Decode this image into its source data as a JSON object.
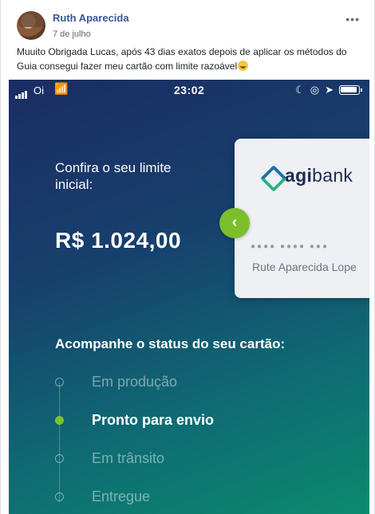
{
  "post": {
    "author": "Ruth Aparecida",
    "date": "7 de julho",
    "more_label": "•••",
    "text": "Muuito Obrigada Lucas, após 43 dias exatos depois de aplicar os métodos do Guia consegui fazer meu cartão com limite razoável",
    "emoji": "laughing-face-emoji"
  },
  "phone": {
    "status_bar": {
      "carrier": "Oi",
      "time": "23:02",
      "icons": [
        "signal-icon",
        "wifi-icon",
        "moon-icon",
        "lock-rotation-icon",
        "location-icon",
        "battery-icon"
      ]
    },
    "confira_label": "Confira o seu limite inicial:",
    "amount": "R$ 1.024,00",
    "card": {
      "brand_prefix": "agi",
      "brand_suffix": "bank",
      "dots": "●●●● ●●●● ●●●",
      "holder": "Rute Aparecida Lope"
    },
    "arrow_glyph": "‹",
    "status_section": {
      "title": "Acompanhe o status do seu cartão:",
      "steps": [
        {
          "label": "Em produção",
          "active": false
        },
        {
          "label": "Pronto para envio",
          "active": true
        },
        {
          "label": "Em trânsito",
          "active": false
        },
        {
          "label": "Entregue",
          "active": false
        }
      ]
    },
    "colors": {
      "accent_green": "#7bbf2a",
      "brand_blue": "#1e2b4f"
    }
  }
}
